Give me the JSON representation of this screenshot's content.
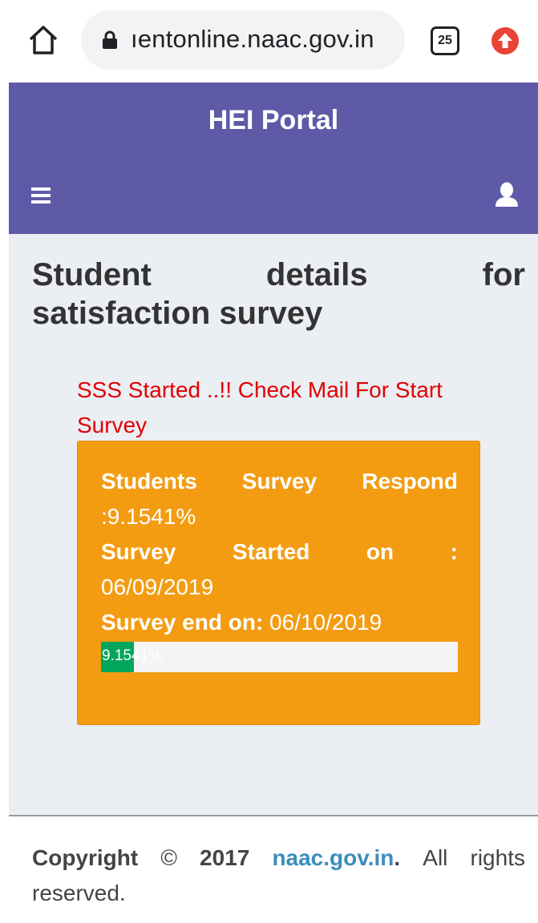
{
  "browser": {
    "url": "ıentonline.naac.gov.in",
    "tab_count": "25",
    "icons": [
      "home-icon",
      "lock-icon",
      "tab-switcher-icon",
      "update-icon"
    ]
  },
  "header": {
    "title": "HEI Portal",
    "icons": [
      "menu-icon",
      "user-icon"
    ],
    "bg_color": "#5e5aa7"
  },
  "page": {
    "title_words": [
      "Student",
      "details",
      "for"
    ],
    "title_line2": "satisfaction survey"
  },
  "survey": {
    "message": "SSS Started ..!! Check Mail For Start Survey",
    "respond_words": [
      "Students",
      "Survey",
      "Respond"
    ],
    "respond_value": ":9.1541%",
    "started_words": [
      "Survey",
      "Started",
      "on",
      ":"
    ],
    "started_value": "06/09/2019",
    "end_label": "Survey end on:",
    "end_value": "06/10/2019",
    "progress_label": "9.1541%",
    "progress_percent": 9.1541,
    "box_color": "#f39c12",
    "progress_color": "#00a65a",
    "message_color": "#e00000"
  },
  "footer": {
    "copyright_words": [
      "Copyright",
      "©",
      "2017"
    ],
    "link": "naac.gov.in",
    "period": ".",
    "rights_words": [
      "All",
      "rights"
    ],
    "line2": "reserved.",
    "link_color": "#3c8dbc"
  }
}
